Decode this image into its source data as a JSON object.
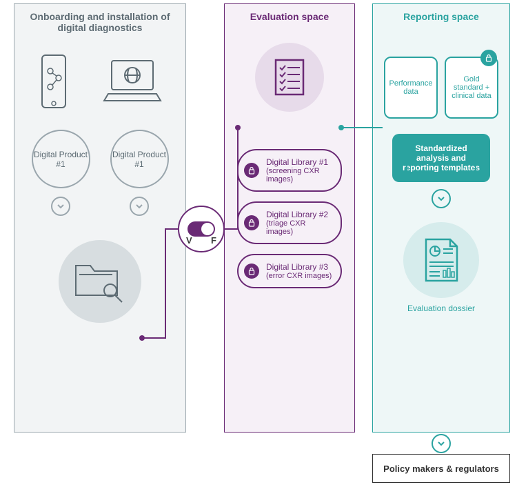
{
  "onboarding": {
    "title": "Onboarding and installation of digital diagnostics",
    "product1": "Digital Product #1",
    "product2": "Digital Product #1"
  },
  "toggle": {
    "v": "V",
    "f": "F"
  },
  "evaluation": {
    "title": "Evaluation space",
    "lib1_name": "Digital Library #1",
    "lib1_sub": "(screening CXR images)",
    "lib2_name": "Digital Library #2",
    "lib2_sub": "(triage CXR images)",
    "lib3_name": "Digital Library #3",
    "lib3_sub": "(error CXR images)"
  },
  "reporting": {
    "title": "Reporting space",
    "perf": "Performance data",
    "gold": "Gold standard + clinical data",
    "std": "Standardized analysis and reporting templates",
    "dossier": "Evaluation dossier"
  },
  "policy": "Policy makers & regulators"
}
